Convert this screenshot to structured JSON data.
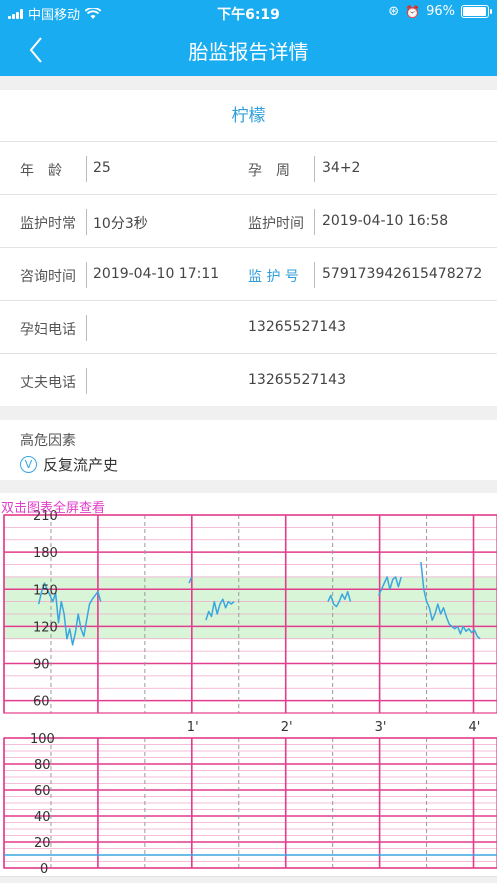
{
  "status_bar": {
    "carrier": "中国移动",
    "time": "下午6:19",
    "battery": "96%"
  },
  "navbar": {
    "title": "胎监报告详情"
  },
  "patient": {
    "name": "柠檬",
    "age_label": "年　龄",
    "age": "25",
    "week_label": "孕　周",
    "week": "34+2",
    "duration_label": "监护时常",
    "duration": "10分3秒",
    "monitor_time_label": "监护时间",
    "monitor_time": "2019-04-10 16:58",
    "consult_time_label": "咨询时间",
    "consult_time": "2019-04-10 17:11",
    "monitor_no_label": "监 护 号",
    "monitor_no": "579173942615478272",
    "mother_phone_label": "孕妇电话",
    "mother_phone": "13265527143",
    "husband_phone_label": "丈夫电话",
    "husband_phone": "13265527143"
  },
  "risk": {
    "title": "高危因素",
    "items": [
      "反复流产史"
    ]
  },
  "chart_hint": "双击图表全屏查看",
  "chart_data": [
    {
      "type": "line",
      "title": "",
      "xlabel": "",
      "ylabel": "",
      "x_unit": "minutes",
      "x_ticks": [
        "1'",
        "2'",
        "3'",
        "4'"
      ],
      "xlim": [
        -1,
        4.25
      ],
      "y_ticks": [
        60,
        90,
        120,
        150,
        180,
        210
      ],
      "ylim": [
        50,
        210
      ],
      "normal_band": [
        110,
        160
      ],
      "colors": {
        "line": "#3aa6de",
        "band": "#d8f5d8",
        "grid_major": "#e23c8c",
        "grid_minor": "#f2a8cc",
        "grid_dash": "#9a9a9a"
      },
      "series": [
        {
          "segments": [
            [
              [
                -0.63,
                138
              ],
              [
                -0.6,
                148
              ],
              [
                -0.57,
                155
              ],
              [
                -0.54,
                150
              ],
              [
                -0.51,
                145
              ],
              [
                -0.48,
                140
              ],
              [
                -0.45,
                147
              ],
              [
                -0.42,
                123
              ],
              [
                -0.39,
                140
              ],
              [
                -0.36,
                130
              ],
              [
                -0.33,
                110
              ],
              [
                -0.3,
                118
              ],
              [
                -0.27,
                105
              ],
              [
                -0.24,
                115
              ],
              [
                -0.21,
                130
              ],
              [
                -0.18,
                118
              ],
              [
                -0.15,
                112
              ],
              [
                -0.12,
                125
              ],
              [
                -0.09,
                138
              ],
              [
                -0.06,
                142
              ],
              [
                -0.03,
                145
              ],
              [
                0.0,
                148
              ],
              [
                0.03,
                140
              ]
            ],
            [
              [
                0.97,
                155
              ],
              [
                1.0,
                160
              ]
            ],
            [
              [
                1.15,
                125
              ],
              [
                1.18,
                132
              ],
              [
                1.21,
                128
              ],
              [
                1.24,
                140
              ],
              [
                1.27,
                130
              ],
              [
                1.3,
                138
              ],
              [
                1.33,
                142
              ],
              [
                1.36,
                135
              ],
              [
                1.39,
                140
              ],
              [
                1.42,
                138
              ],
              [
                1.45,
                140
              ]
            ],
            [
              [
                2.45,
                140
              ],
              [
                2.48,
                145
              ],
              [
                2.51,
                138
              ],
              [
                2.54,
                136
              ],
              [
                2.57,
                140
              ],
              [
                2.6,
                146
              ],
              [
                2.63,
                142
              ],
              [
                2.66,
                148
              ],
              [
                2.69,
                140
              ]
            ],
            [
              [
                2.99,
                145
              ],
              [
                3.02,
                150
              ],
              [
                3.05,
                155
              ],
              [
                3.08,
                160
              ],
              [
                3.11,
                150
              ],
              [
                3.14,
                158
              ],
              [
                3.17,
                160
              ],
              [
                3.2,
                152
              ],
              [
                3.23,
                160
              ]
            ],
            [
              [
                3.44,
                172
              ],
              [
                3.47,
                150
              ],
              [
                3.5,
                140
              ],
              [
                3.53,
                135
              ],
              [
                3.56,
                125
              ],
              [
                3.59,
                130
              ],
              [
                3.62,
                138
              ],
              [
                3.65,
                130
              ],
              [
                3.68,
                135
              ],
              [
                3.71,
                128
              ],
              [
                3.74,
                122
              ],
              [
                3.77,
                120
              ],
              [
                3.8,
                118
              ],
              [
                3.83,
                120
              ],
              [
                3.86,
                114
              ],
              [
                3.89,
                120
              ],
              [
                3.92,
                116
              ],
              [
                3.95,
                118
              ],
              [
                3.98,
                115
              ],
              [
                4.01,
                117
              ],
              [
                4.04,
                112
              ],
              [
                4.07,
                110
              ]
            ]
          ]
        }
      ]
    },
    {
      "type": "line",
      "title": "",
      "xlabel": "",
      "ylabel": "",
      "x_unit": "minutes",
      "xlim": [
        -1,
        4.25
      ],
      "y_ticks": [
        0,
        20,
        40,
        60,
        80,
        100
      ],
      "ylim": [
        0,
        100
      ],
      "colors": {
        "line": "#3aa6de"
      },
      "series": [
        {
          "segments": [
            [
              [
                -1,
                10
              ],
              [
                4.25,
                10
              ]
            ]
          ]
        }
      ]
    }
  ]
}
